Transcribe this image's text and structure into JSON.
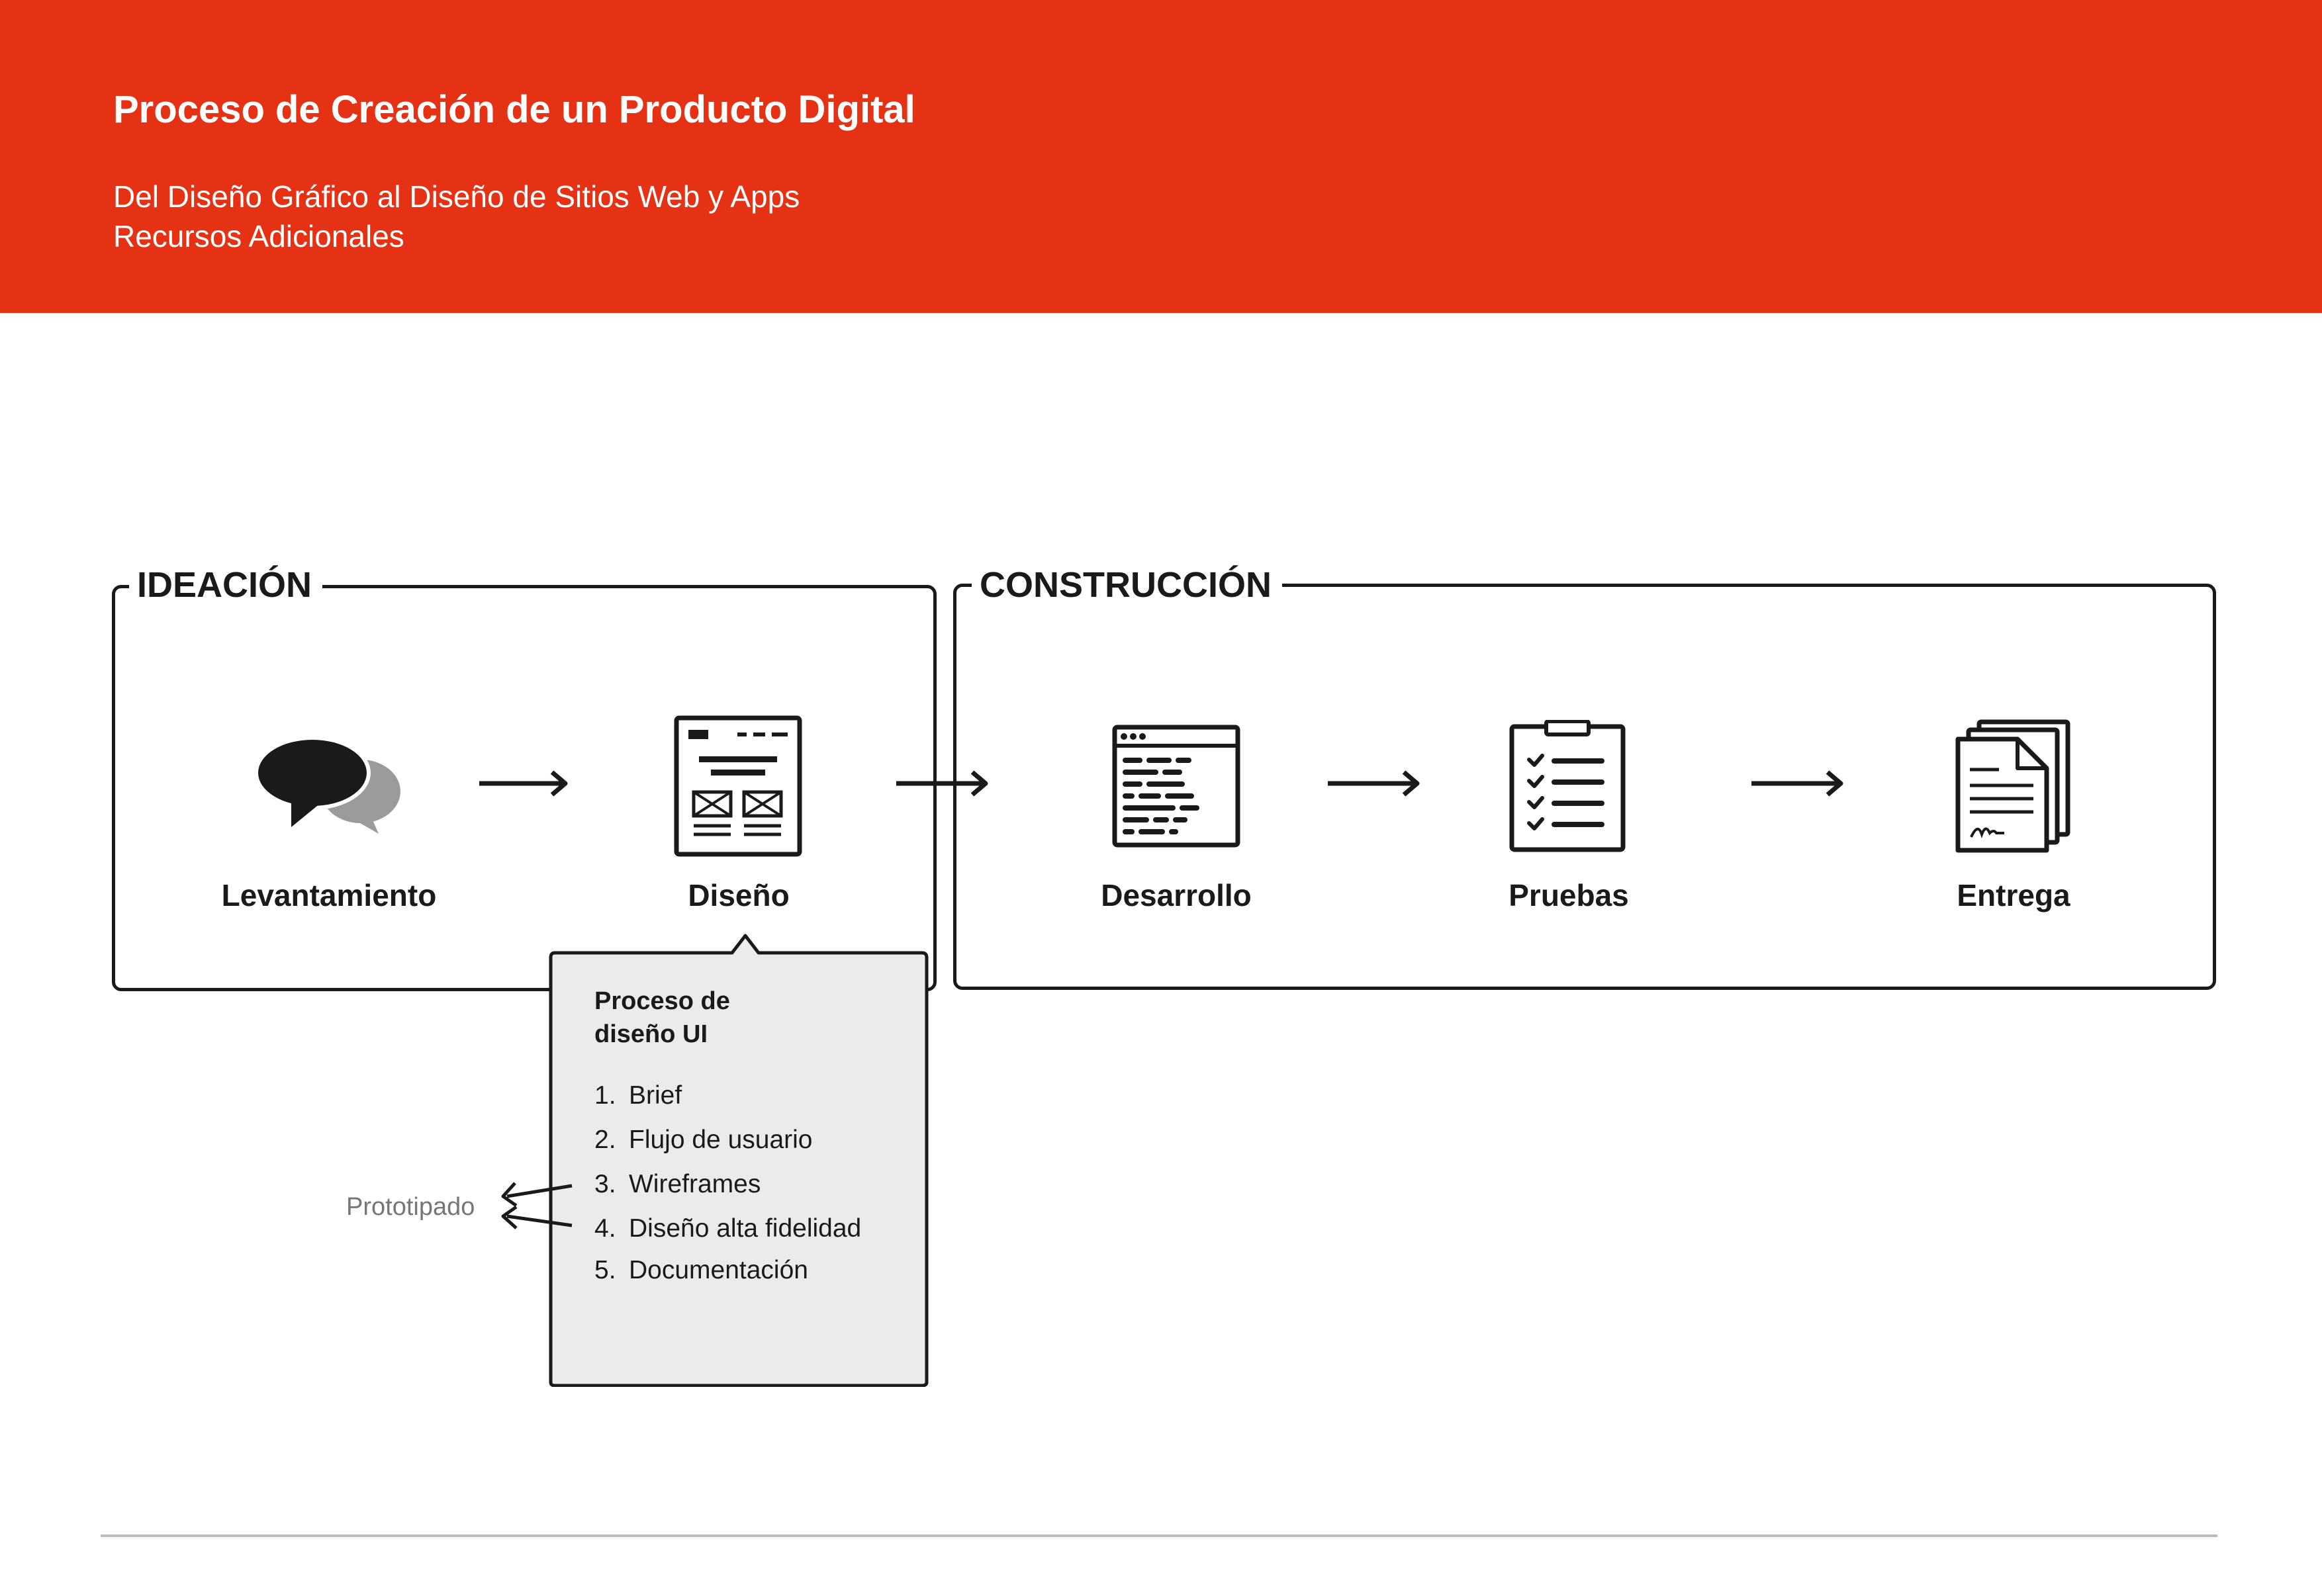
{
  "header": {
    "title": "Proceso de Creación de un Producto Digital",
    "subtitle_line1": "Del Diseño Gráfico al Diseño de Sitios Web y Apps",
    "subtitle_line2": "Recursos Adicionales",
    "background_color": "#e53214"
  },
  "groups": {
    "ideacion": {
      "label": "IDEACIÓN"
    },
    "construccion": {
      "label": "CONSTRUCCIÓN"
    }
  },
  "steps": [
    {
      "label": "Levantamiento",
      "icon": "speech-bubbles-icon"
    },
    {
      "label": "Diseño",
      "icon": "wireframe-layout-icon"
    },
    {
      "label": "Desarrollo",
      "icon": "code-window-icon"
    },
    {
      "label": "Pruebas",
      "icon": "checklist-clipboard-icon"
    },
    {
      "label": "Entrega",
      "icon": "signed-documents-icon"
    }
  ],
  "design_process": {
    "title": "Proceso de diseño UI",
    "items": [
      {
        "num": "1.",
        "text": "Brief"
      },
      {
        "num": "2.",
        "text": "Flujo de usuario"
      },
      {
        "num": "3.",
        "text": "Wireframes"
      },
      {
        "num": "4.",
        "text": "Diseño alta fidelidad"
      },
      {
        "num": "5.",
        "text": "Documentación"
      }
    ],
    "side_note": "Prototipado"
  },
  "colors": {
    "accent": "#e53214",
    "ink": "#1a1a1a",
    "callout_bg": "#ebebeb",
    "muted_text": "#777777"
  }
}
